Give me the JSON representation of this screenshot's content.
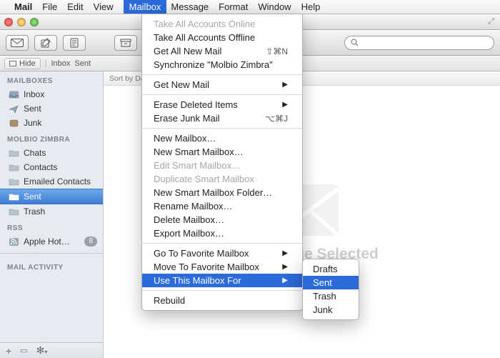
{
  "menubar": {
    "apple": "",
    "app": "Mail",
    "items": [
      "File",
      "Edit",
      "View",
      "Mailbox",
      "Message",
      "Format",
      "Window",
      "Help"
    ],
    "selected_index": 3
  },
  "toolbar": {
    "icons": [
      "inbox-icon",
      "compose-icon",
      "note-icon",
      "archive-icon"
    ],
    "search_placeholder": ""
  },
  "favbar": {
    "hide": "Hide",
    "items": [
      "Inbox",
      "Sent"
    ]
  },
  "sidebar": {
    "s1": {
      "head": "MAILBOXES",
      "items": [
        {
          "label": "Inbox",
          "icon": "inbox"
        },
        {
          "label": "Sent",
          "icon": "sent"
        },
        {
          "label": "Junk",
          "icon": "junk"
        }
      ]
    },
    "s2": {
      "head": "MOLBIO ZIMBRA",
      "items": [
        {
          "label": "Chats",
          "icon": "folder"
        },
        {
          "label": "Contacts",
          "icon": "folder"
        },
        {
          "label": "Emailed Contacts",
          "icon": "folder"
        },
        {
          "label": "Sent",
          "icon": "folder",
          "selected": true
        },
        {
          "label": "Trash",
          "icon": "folder"
        }
      ]
    },
    "s3": {
      "head": "RSS",
      "items": [
        {
          "label": "Apple Hot…",
          "icon": "rss",
          "badge": "8"
        }
      ]
    },
    "s4": {
      "head": "MAIL ACTIVITY"
    }
  },
  "content": {
    "sort_label": "Sort by Da",
    "empty_text": "No Message Selected"
  },
  "menu": {
    "groups": [
      [
        {
          "label": "Take All Accounts Online",
          "disabled": true
        },
        {
          "label": "Take All Accounts Offline"
        },
        {
          "label": "Get All New Mail",
          "shortcut": "⇧⌘N"
        },
        {
          "label": "Synchronize \"Molbio Zimbra\""
        }
      ],
      [
        {
          "label": "Get New Mail",
          "submenu": true
        }
      ],
      [
        {
          "label": "Erase Deleted Items",
          "submenu": true
        },
        {
          "label": "Erase Junk Mail",
          "shortcut": "⌥⌘J"
        }
      ],
      [
        {
          "label": "New Mailbox…"
        },
        {
          "label": "New Smart Mailbox…"
        },
        {
          "label": "Edit Smart Mailbox…",
          "disabled": true
        },
        {
          "label": "Duplicate Smart Mailbox",
          "disabled": true
        },
        {
          "label": "New Smart Mailbox Folder…"
        },
        {
          "label": "Rename Mailbox…"
        },
        {
          "label": "Delete Mailbox…"
        },
        {
          "label": "Export Mailbox…"
        }
      ],
      [
        {
          "label": "Go To Favorite Mailbox",
          "submenu": true
        },
        {
          "label": "Move To Favorite Mailbox",
          "submenu": true
        },
        {
          "label": "Use This Mailbox For",
          "submenu": true,
          "selected": true
        }
      ],
      [
        {
          "label": "Rebuild"
        }
      ]
    ]
  },
  "submenu": {
    "items": [
      {
        "label": "Drafts"
      },
      {
        "label": "Sent",
        "selected": true
      },
      {
        "label": "Trash"
      },
      {
        "label": "Junk"
      }
    ]
  }
}
